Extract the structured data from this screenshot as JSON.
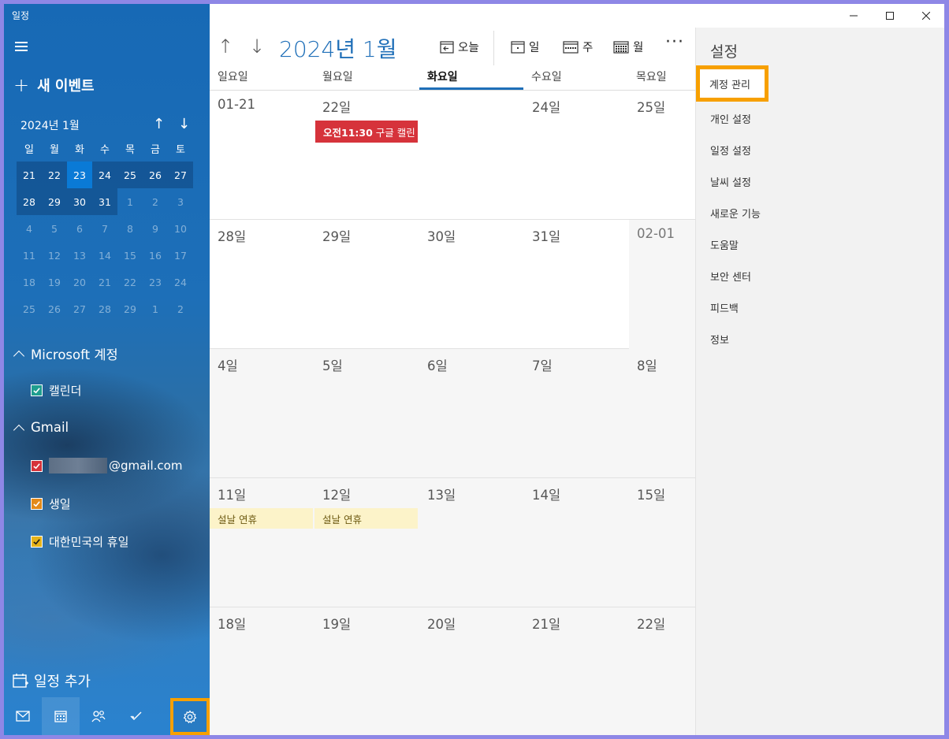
{
  "app": {
    "title": "일정"
  },
  "sidebar": {
    "new_event_plus": "+",
    "new_event": "새 이벤트",
    "mini_month_label": "2024년 1월",
    "up_arrow": "↑",
    "down_arrow": "↓",
    "weekdays": [
      "일",
      "월",
      "화",
      "수",
      "목",
      "금",
      "토"
    ],
    "weeks": [
      [
        "21",
        "22",
        "23",
        "24",
        "25",
        "26",
        "27"
      ],
      [
        "28",
        "29",
        "30",
        "31",
        "1",
        "2",
        "3"
      ],
      [
        "4",
        "5",
        "6",
        "7",
        "8",
        "9",
        "10"
      ],
      [
        "11",
        "12",
        "13",
        "14",
        "15",
        "16",
        "17"
      ],
      [
        "18",
        "19",
        "20",
        "21",
        "22",
        "23",
        "24"
      ],
      [
        "25",
        "26",
        "27",
        "28",
        "29",
        "1",
        "2"
      ]
    ],
    "groups": {
      "microsoft": {
        "label": "Microsoft 계정",
        "items": [
          {
            "label": "캘린더",
            "color": "#1f9e8f"
          }
        ]
      },
      "gmail": {
        "label": "Gmail",
        "items": [
          {
            "label": "@gmail.com",
            "color": "#d6333b"
          },
          {
            "label": "생일",
            "color": "#e38a1a"
          },
          {
            "label": "대한민국의 휴일",
            "color": "#e6b319"
          }
        ]
      }
    },
    "add_calendar": "일정 추가"
  },
  "toolbar": {
    "month_title": "2024년 1월",
    "today": "오늘",
    "day": "일",
    "week": "주",
    "month": "월",
    "more": "···"
  },
  "week_header": [
    "일요일",
    "월요일",
    "화요일",
    "수요일",
    "목요일"
  ],
  "calendar_rows": [
    [
      "01-21",
      "22일",
      "",
      "24일",
      "25일"
    ],
    [
      "28일",
      "29일",
      "30일",
      "31일",
      "02-01"
    ],
    [
      "4일",
      "5일",
      "6일",
      "7일",
      "8일"
    ],
    [
      "11일",
      "12일",
      "13일",
      "14일",
      "15일"
    ],
    [
      "18일",
      "19일",
      "20일",
      "21일",
      "22일"
    ]
  ],
  "events": {
    "google": {
      "time": "오전11:30",
      "title": "구글 캘린"
    },
    "holiday1": "설날 연휴",
    "holiday2": "설날 연휴"
  },
  "settings": {
    "title": "설정",
    "items": [
      "계정 관리",
      "개인 설정",
      "일정 설정",
      "날씨 설정",
      "새로운 기능",
      "도움말",
      "보안 센터",
      "피드백",
      "정보"
    ]
  },
  "colors": {
    "accent": "#1f6fb8",
    "highlight": "#f7a000",
    "event_red": "#d6333b",
    "holiday": "#fcf3c9"
  }
}
